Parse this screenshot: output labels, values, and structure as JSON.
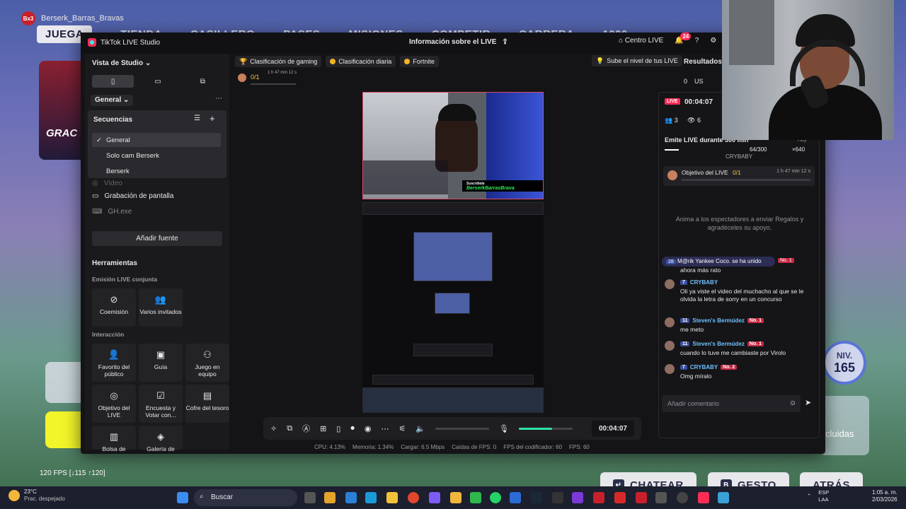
{
  "game": {
    "username": "Berserk_Barras_Bravas",
    "logo_text": "Bx3",
    "nav": [
      "JUEGA",
      "TIENDA",
      "CASILLERO",
      "PASES",
      "MISIONES",
      "COMPETIR",
      "CARRERA",
      "1000"
    ],
    "card_text": "GRAC",
    "fps_text": "120 FPS [↓115 ↑120]",
    "level_label": "NIV.",
    "level_value": "165",
    "incluidas": "cluidas",
    "bottom_buttons": [
      {
        "key": "↵",
        "label": "CHATEAR"
      },
      {
        "key": "B",
        "label": "GESTO"
      },
      {
        "key": "",
        "label": "ATRÁS"
      }
    ]
  },
  "studio": {
    "app_title": "TikTok LIVE Studio",
    "center_title": "Información sobre el LIVE",
    "centro_live": "Centro LIVE",
    "notif_count": "24",
    "left": {
      "view_label": "Vista de Studio",
      "general_dropdown": "General",
      "sequences_title": "Secuencias",
      "sequences": [
        "General",
        "Solo cam Berserk",
        "Berserk"
      ],
      "selected_sequence": "General",
      "sources": [
        "Vídeo",
        "Grabación de pantalla",
        "GH.exe"
      ],
      "add_source": "Añadir fuente",
      "tools_title": "Herramientas",
      "section_joint": "Emisión LIVE conjunta",
      "joint_tools": [
        "Coemisión",
        "Varios invitados"
      ],
      "section_interaction": "Interacción",
      "interaction_tools": [
        "Favorito del público",
        "Guía",
        "Juego en equipo",
        "Objetivo del LIVE",
        "Encuesta y Votar con...",
        "Cofre del tesoro",
        "Bolsa de",
        "Galería de"
      ]
    },
    "chips": [
      "Clasificación de gaming",
      "Clasificación diaria",
      "Fortnite"
    ],
    "level_up": "Sube el nivel de tus LIVE",
    "mini_goal": {
      "count": "0/1",
      "time": "1 h 47 min 12 s"
    },
    "preview": {
      "brand_text": "BerserkBarrasBrava",
      "sub_text": "Suscríbete"
    },
    "controls": {
      "timer": "00:04:07",
      "mic_level": 0.62
    },
    "stats": [
      "CPU: 4.13%",
      "Memoria: 1.34%",
      "Cargar: 6.5 Mbps",
      "Caídas de FPS: 0",
      "FPS del codificador: 60",
      "FPS: 60"
    ],
    "live_panel": {
      "live_tag": "LIVE",
      "timer": "00:04:07",
      "viewers": "3",
      "views": "6",
      "emit_title": "Emite LIVE durante 300 min",
      "emit_progress": "64/300",
      "emit_today": "Hoy",
      "emit_reward": "×640",
      "goal_title": "Objetivo del LIVE",
      "goal_count": "0/1",
      "goal_time": "1 h 47 min 12 s",
      "empty_text": "Anima a los espectadores a enviar Regalos y agradéceles su apoyo.",
      "join_text": "M@rik Yankee Coco. se ha unido",
      "join_level": "28",
      "messages": [
        {
          "level": "",
          "name": "",
          "rank": "",
          "text": "ahora más rato"
        },
        {
          "level": "7",
          "name": "CRYBABY",
          "rank": "",
          "text": "Oli ya viste el video del muchacho al que se le olvida la letra de sorry en un concurso"
        },
        {
          "level": "11",
          "name": "Steven's Bermúdez",
          "rank": "No. 1",
          "text": "me meto"
        },
        {
          "level": "11",
          "name": "Steven's Bermúdez",
          "rank": "No. 1",
          "text": "cuando lo tuve me cambiaste por Virolo"
        },
        {
          "level": "7",
          "name": "CRYBABY",
          "rank": "No. 2",
          "text": "Omg míralo"
        }
      ],
      "comment_placeholder": "Añadir comentario",
      "overlay_name": "CRYBABY",
      "overlay_rank": "No. 1"
    },
    "results": {
      "title": "Resultados",
      "coins": "0",
      "usd": "US"
    }
  },
  "taskbar": {
    "temp": "23°C",
    "weather": "Prac. despejado",
    "search": "Buscar",
    "lang": "ESP",
    "lang2": "LAA",
    "time": "1:05 a. m.",
    "date": "2/03/2026"
  }
}
